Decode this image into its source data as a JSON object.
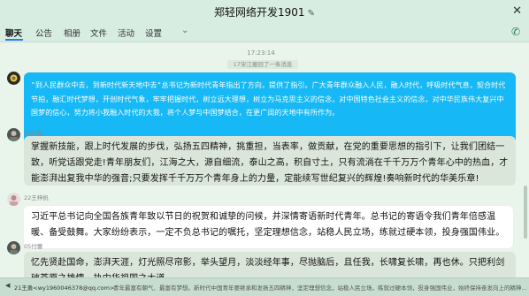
{
  "window": {
    "title": "郑轻网络开发1901",
    "edit_icon": "pencil-icon",
    "close_icon": "close-icon"
  },
  "tabs": [
    "聊天",
    "公告",
    "相册",
    "文件",
    "活动",
    "设置"
  ],
  "active_tab": "聊天",
  "header": {
    "call_icon": "phone-icon"
  },
  "feed": {
    "time": "17:23:14",
    "recall_notice": "17宋江撤回了一条消息",
    "messages": [
      {
        "sender": "",
        "text": "\"到人民群众中去，到新时代新天地中去\"总书记为新时代青年指出了方向，提供了指引。广大青年群众融入人民，融入时代，呼吸时代气息，契合时代节拍，融汇时代梦想，开创时代气象，牢牢把握时代，树立远大理想，树立为马克思主义的信念，对中国特色社会主义的信念，对中华民族伟大复兴中国梦的信心，努力将小我融入时代的大我，将个人梦与中国梦结合，在更广阔的天地中有所作为。"
      },
      {
        "sender": "05付蕾",
        "text": "掌握新技能，跟上时代发展的步伐，弘扬五四精神，挑重担，当表率，做贡献，在党的重要思想的指引下，让我们团结一致，听党话跟党走!青年朋友们，江海之大，源自细流，泰山之高，积自寸土，只有流淌在千千万万个青年心中的热血，才能澎湃出复我中华的强音;只要发挥千千万万个青年身上的力量，定能续写世纪复兴的辉煌!奏响新时代的华美乐章!"
      },
      {
        "sender": "22王梓帆",
        "text": "习近平总书记向全国各族青年致以节日的祝贺和诚挚的问候，并深情寄语新时代青年。总书记的寄语令我们青年倍感温暖、备受鼓舞。大家纷纷表示，一定不负总书记的嘱托，坚定理想信念，站稳人民立场，练就过硬本领，投身强国伟业。"
      },
      {
        "sender": "05付蕾",
        "text": "忆先贤赴国命，澎湃天涯，灯光照尽帘影，举头望月，淡淡经年事，尽抛脑后，且任我，长啸复长啸，再也休。只把利剑破苍原之雄情，执中华祖国之大道。"
      }
    ]
  },
  "status_bar": {
    "name": "21王勇<wy1960046378@qq.com>：",
    "preview": "青年最富有朝气、最富有梦想。新时代中国青年要继承和发扬五四精神，坚定理想信念，站稳人民立场，练就过硬本领，投身强国伟业，始终保持奋发向上的精神..."
  }
}
